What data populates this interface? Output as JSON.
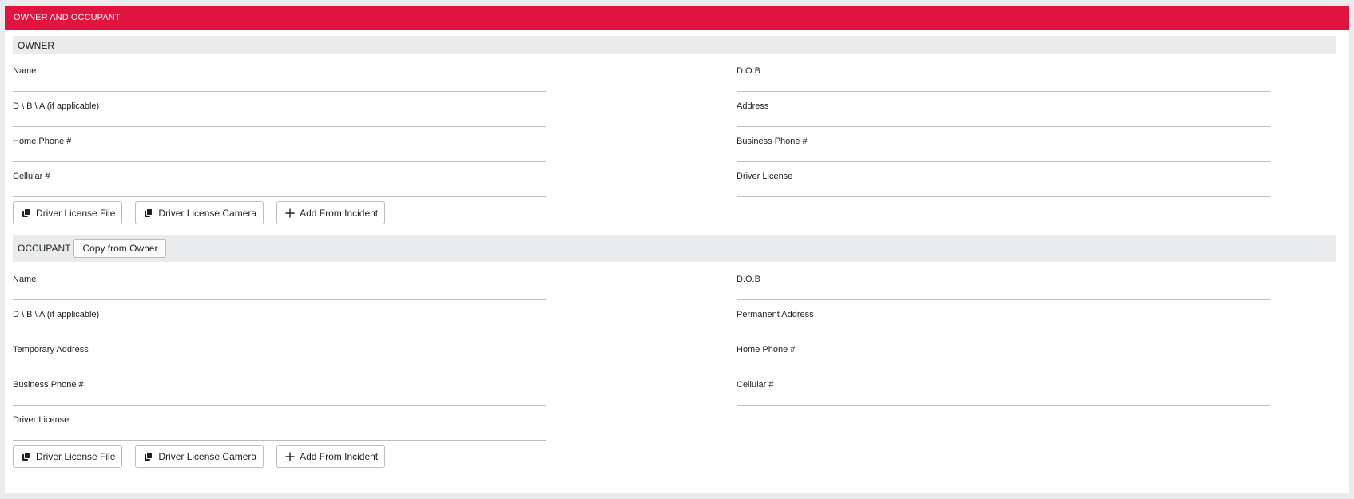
{
  "panel": {
    "title": "OWNER AND OCCUPANT"
  },
  "owner": {
    "heading": "OWNER",
    "fields": {
      "name": {
        "label": "Name",
        "value": ""
      },
      "dob": {
        "label": "D.O.B",
        "value": ""
      },
      "dba": {
        "label": "D \\ B \\ A (if applicable)",
        "value": ""
      },
      "address": {
        "label": "Address",
        "value": ""
      },
      "home_phone": {
        "label": "Home Phone #",
        "value": ""
      },
      "business_phone": {
        "label": "Business Phone #",
        "value": ""
      },
      "cellular": {
        "label": "Cellular #",
        "value": ""
      },
      "driver_license": {
        "label": "Driver License",
        "value": ""
      }
    },
    "buttons": {
      "license_file": "Driver License File",
      "license_camera": "Driver License Camera",
      "add_from_incident": "Add From Incident"
    }
  },
  "occupant": {
    "heading": "OCCUPANT",
    "copy_button": "Copy from Owner",
    "fields": {
      "name": {
        "label": "Name",
        "value": ""
      },
      "dob": {
        "label": "D.O.B",
        "value": ""
      },
      "dba": {
        "label": "D \\ B \\ A (if applicable)",
        "value": ""
      },
      "permanent_address": {
        "label": "Permanent Address",
        "value": ""
      },
      "temporary_address": {
        "label": "Temporary Address",
        "value": ""
      },
      "home_phone": {
        "label": "Home Phone #",
        "value": ""
      },
      "business_phone": {
        "label": "Business Phone #",
        "value": ""
      },
      "cellular": {
        "label": "Cellular #",
        "value": ""
      },
      "driver_license": {
        "label": "Driver License",
        "value": ""
      }
    },
    "buttons": {
      "license_file": "Driver License File",
      "license_camera": "Driver License Camera",
      "add_from_incident": "Add From Incident"
    }
  },
  "icons": {
    "file": "copy-icon",
    "camera": "copy-icon",
    "add": "plus-icon"
  },
  "colors": {
    "header": "#e0143f",
    "section_bg": "#e9ebed"
  }
}
